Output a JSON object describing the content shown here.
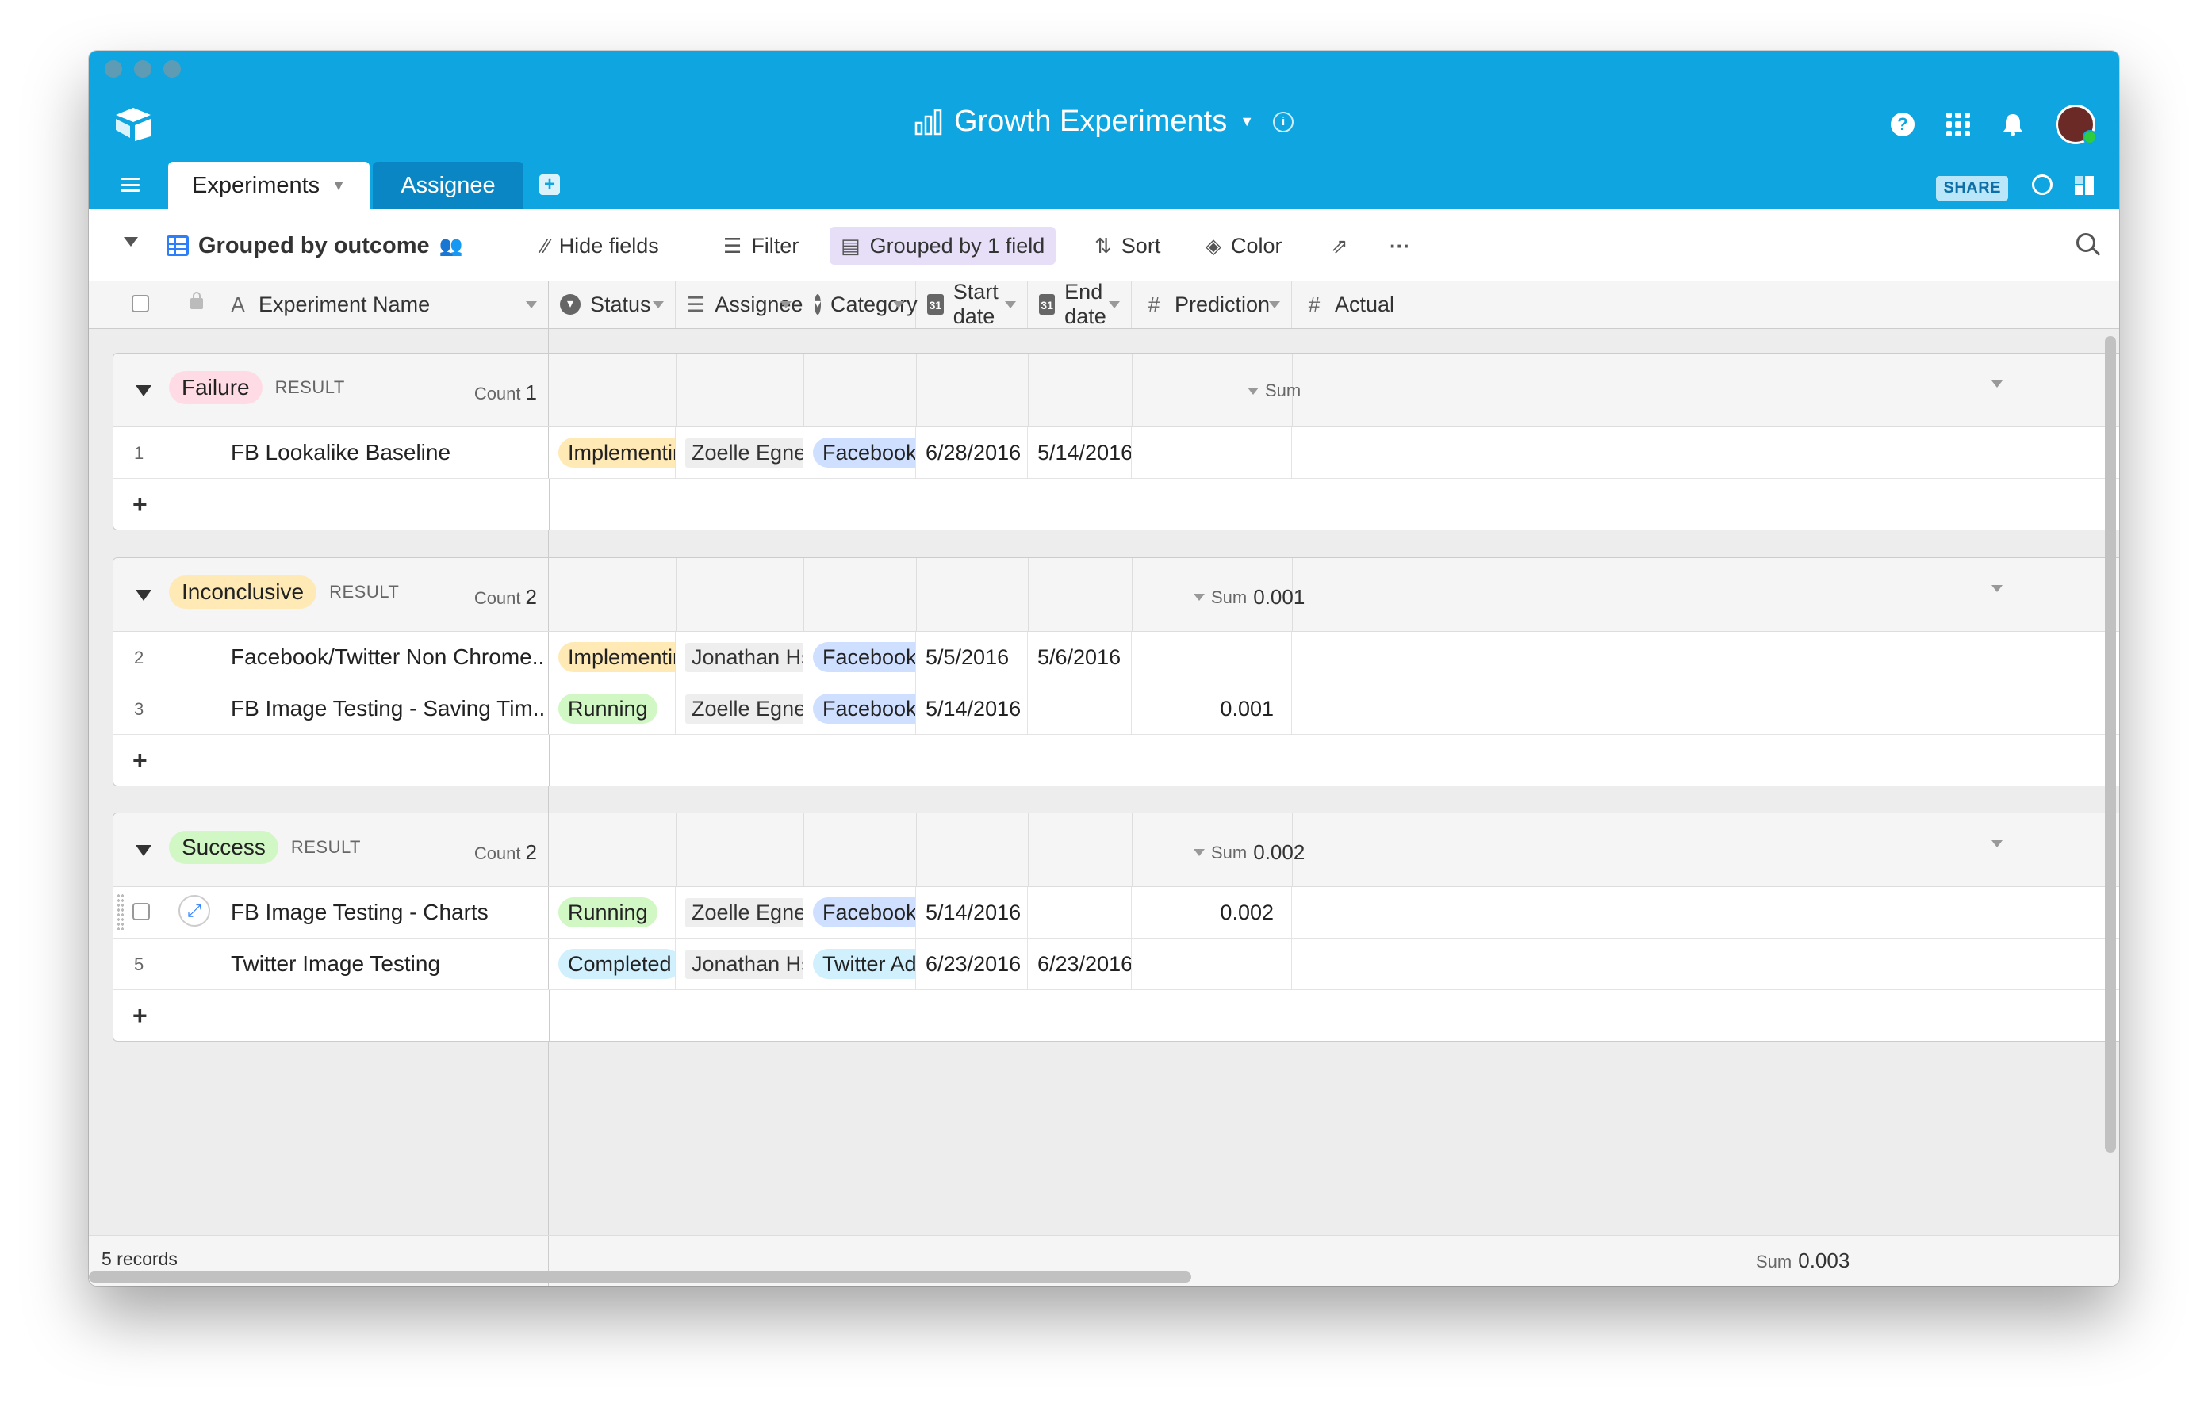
{
  "app": {
    "title": "Growth Experiments",
    "share_label": "SHARE",
    "colors": {
      "brand": "#0ea5e0",
      "tab_inactive": "#0b86c4",
      "grouped_bg": "#e6dff7"
    }
  },
  "tabs": [
    {
      "label": "Experiments"
    },
    {
      "label": "Assignee"
    }
  ],
  "toolbar": {
    "view_name": "Grouped by outcome",
    "hide_fields": "Hide fields",
    "filter": "Filter",
    "grouped": "Grouped by 1 field",
    "sort": "Sort",
    "color": "Color"
  },
  "columns": [
    {
      "label": "Experiment Name",
      "icon": "text-field-icon"
    },
    {
      "label": "Status",
      "icon": "single-select-icon"
    },
    {
      "label": "Assignee",
      "icon": "collaborator-icon"
    },
    {
      "label": "Category",
      "icon": "single-select-icon"
    },
    {
      "label": "Start date",
      "icon": "calendar-icon"
    },
    {
      "label": "End date",
      "icon": "calendar-icon"
    },
    {
      "label": "Prediction",
      "icon": "number-icon"
    },
    {
      "label": "Actual",
      "icon": "number-icon"
    }
  ],
  "groups": [
    {
      "label": "Failure",
      "color": "#ffdce5",
      "field": "RESULT",
      "count_label": "Count",
      "count": "1",
      "sum_label": "Sum",
      "sum": "",
      "rows": [
        {
          "num": "1",
          "name": "FB Lookalike Baseline",
          "status": "Implementing",
          "assignee": "Zoelle Egner",
          "category": "Facebook Ads",
          "start": "6/28/2016",
          "end": "5/14/2016",
          "prediction": ""
        }
      ]
    },
    {
      "label": "Inconclusive",
      "color": "#ffeab6",
      "field": "RESULT",
      "count_label": "Count",
      "count": "2",
      "sum_label": "Sum",
      "sum": "0.001",
      "rows": [
        {
          "num": "2",
          "name": "Facebook/Twitter Non Chrome..",
          "status": "Implementing",
          "assignee": "Jonathan Hsieh",
          "category": "Facebook Ads",
          "start": "5/5/2016",
          "end": "5/6/2016",
          "prediction": ""
        },
        {
          "num": "3",
          "name": "FB Image Testing - Saving Tim..",
          "status": "Running",
          "assignee": "Zoelle Egner",
          "category": "Facebook Ads",
          "start": "5/14/2016",
          "end": "",
          "prediction": "0.001"
        }
      ]
    },
    {
      "label": "Success",
      "color": "#d1f7c4",
      "field": "RESULT",
      "count_label": "Count",
      "count": "2",
      "sum_label": "Sum",
      "sum": "0.002",
      "rows": [
        {
          "num": "",
          "name": "FB Image Testing - Charts",
          "status": "Running",
          "assignee": "Zoelle Egner",
          "category": "Facebook Ads",
          "start": "5/14/2016",
          "end": "",
          "prediction": "0.002"
        },
        {
          "num": "5",
          "name": "Twitter Image Testing",
          "status": "Completed",
          "assignee": "Jonathan Hsieh",
          "category": "Twitter Ads",
          "start": "6/23/2016",
          "end": "6/23/2016",
          "prediction": ""
        }
      ]
    }
  ],
  "footer": {
    "records": "5 records",
    "sum_label": "Sum",
    "sum": "0.003"
  }
}
